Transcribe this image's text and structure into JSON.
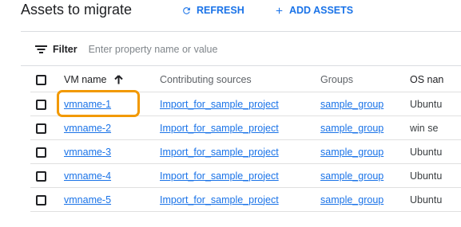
{
  "header": {
    "title": "Assets to migrate",
    "refresh_label": "REFRESH",
    "add_label": "ADD ASSETS"
  },
  "filter": {
    "label": "Filter",
    "placeholder": "Enter property name or value"
  },
  "table": {
    "columns": [
      "VM name",
      "Contributing sources",
      "Groups",
      "OS nan"
    ],
    "sort": {
      "column": "VM name",
      "direction": "ascending"
    },
    "rows": [
      {
        "vm": "vmname-1",
        "source": "Import_for_sample_project",
        "group": "sample_group",
        "os": "Ubuntu"
      },
      {
        "vm": "vmname-2",
        "source": "Import_for_sample_project",
        "group": "sample_group",
        "os": "win se"
      },
      {
        "vm": "vmname-3",
        "source": "Import_for_sample_project",
        "group": "sample_group",
        "os": "Ubuntu"
      },
      {
        "vm": "vmname-4",
        "source": "Import_for_sample_project",
        "group": "sample_group",
        "os": "Ubuntu"
      },
      {
        "vm": "vmname-5",
        "source": "Import_for_sample_project",
        "group": "sample_group",
        "os": "Ubuntu"
      }
    ]
  },
  "colors": {
    "accent": "#1a73e8",
    "highlight": "#f29900"
  },
  "icons": {
    "refresh": "refresh-icon",
    "add": "plus-icon",
    "filter": "filter-lines-icon",
    "sort": "arrow-up-icon"
  }
}
